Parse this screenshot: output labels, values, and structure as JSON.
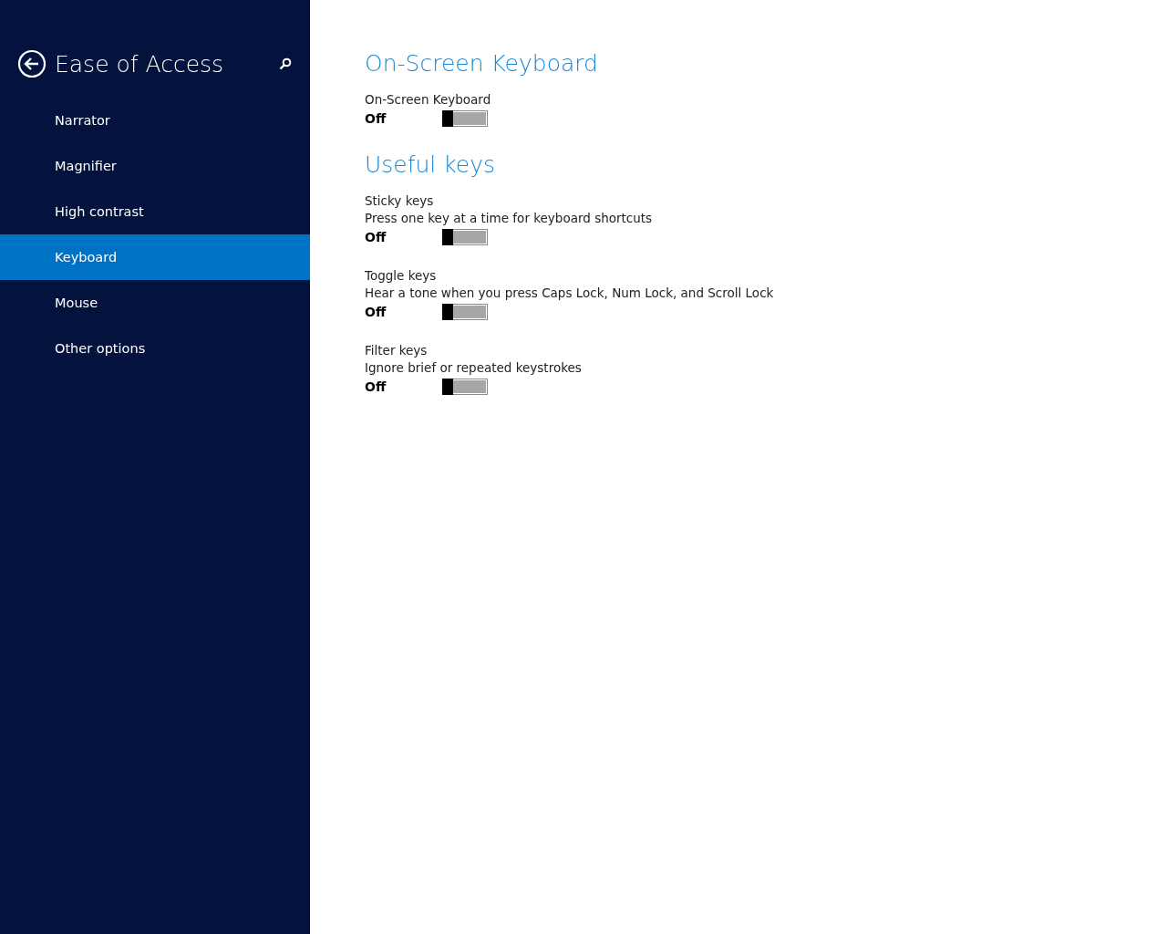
{
  "sidebar": {
    "title": "Ease of Access",
    "items": [
      {
        "label": "Narrator",
        "selected": false
      },
      {
        "label": "Magnifier",
        "selected": false
      },
      {
        "label": "High contrast",
        "selected": false
      },
      {
        "label": "Keyboard",
        "selected": true
      },
      {
        "label": "Mouse",
        "selected": false
      },
      {
        "label": "Other options",
        "selected": false
      }
    ]
  },
  "sections": [
    {
      "heading": "On-Screen Keyboard",
      "settings": [
        {
          "label": "On-Screen Keyboard",
          "state_text": "Off",
          "on": false
        }
      ]
    },
    {
      "heading": "Useful keys",
      "settings": [
        {
          "label": "Sticky keys",
          "description": "Press one key at a time for keyboard shortcuts",
          "state_text": "Off",
          "on": false
        },
        {
          "label": "Toggle keys",
          "description": "Hear a tone when you press Caps Lock, Num Lock, and Scroll Lock",
          "state_text": "Off",
          "on": false
        },
        {
          "label": "Filter keys",
          "description": "Ignore brief or repeated keystrokes",
          "state_text": "Off",
          "on": false
        }
      ]
    }
  ]
}
